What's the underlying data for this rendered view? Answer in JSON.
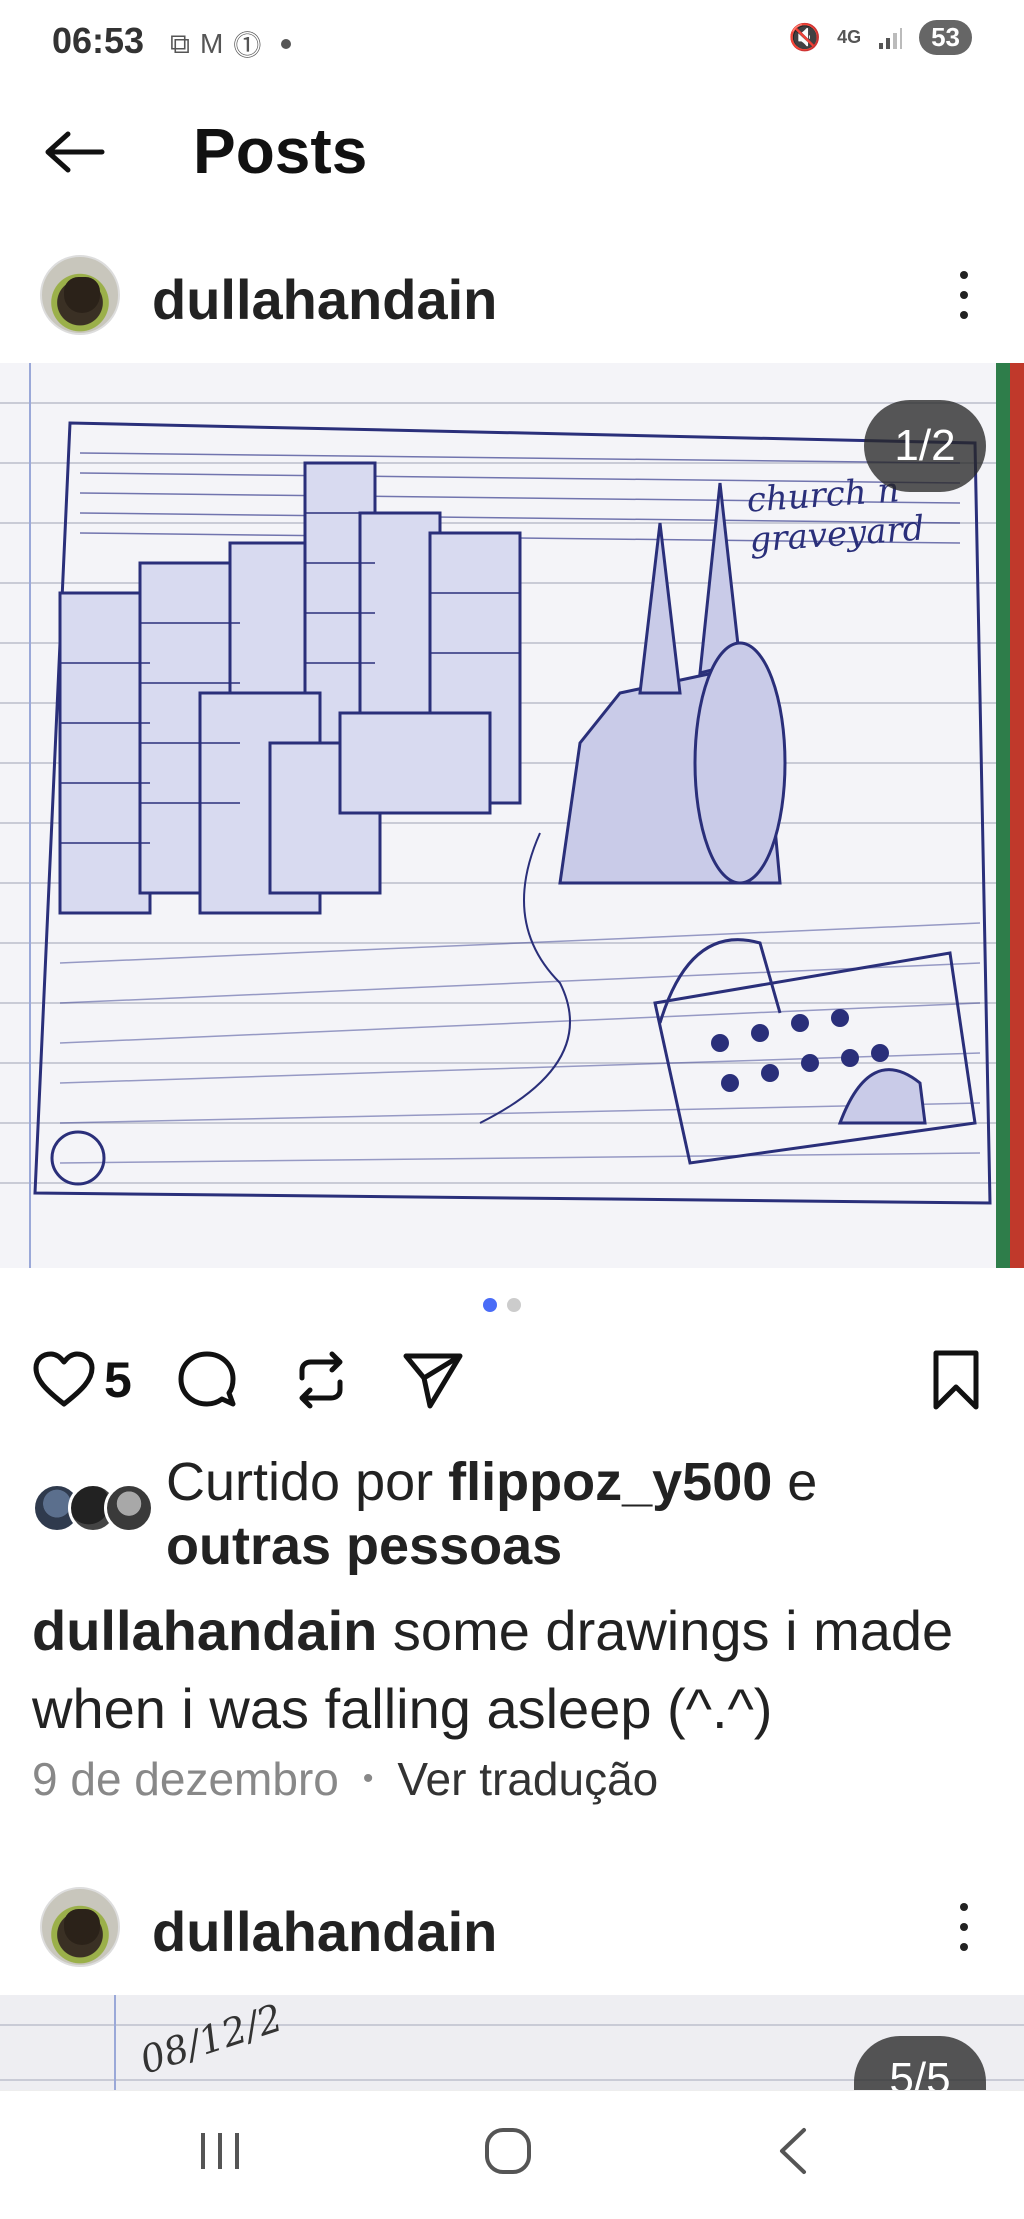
{
  "status_bar": {
    "time": "06:53",
    "left_icons": [
      "screenshot-icon",
      "gmail-icon",
      "notification-icon"
    ],
    "right_icons": [
      "mute-icon",
      "network-4g-icon",
      "signal-icon"
    ],
    "network": "4G",
    "battery": "53"
  },
  "header": {
    "title": "Posts"
  },
  "post1": {
    "username": "dullahandain",
    "image_counter": "1/2",
    "drawing_text": "church n graveyard",
    "carousel": {
      "count": 2,
      "active_index": 1
    },
    "like_count": "5",
    "liked_by": {
      "prefix": "Curtido por",
      "user": "flippoz_y500",
      "joiner": "e",
      "others": "outras pessoas"
    },
    "caption": {
      "username": "dullahandain",
      "text": "some drawings i made when i was falling asleep (^.^)"
    },
    "date": "9 de dezembro",
    "translate_label": "Ver tradução"
  },
  "post2": {
    "username": "dullahandain",
    "image_counter": "5/5",
    "image_text": "08/12/2"
  },
  "nav": {
    "icons": [
      "recent-apps-icon",
      "home-icon",
      "back-icon"
    ]
  }
}
